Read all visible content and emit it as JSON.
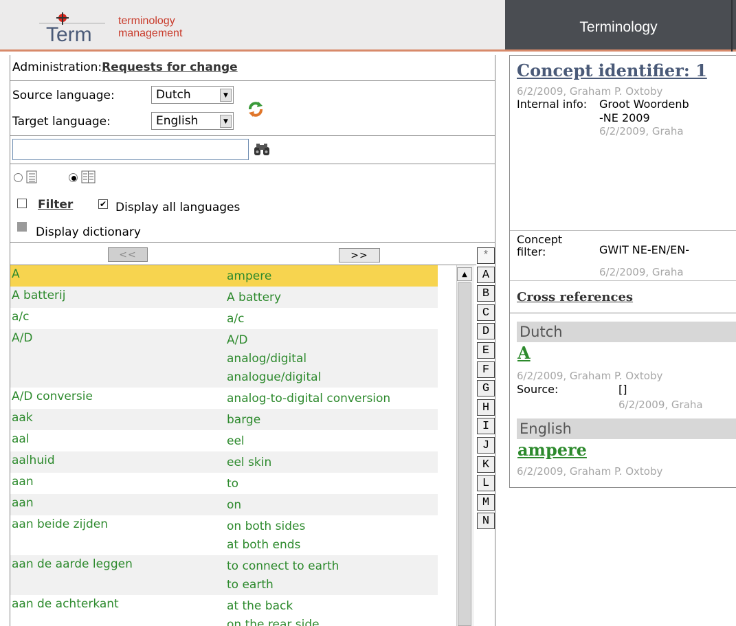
{
  "header": {
    "logo_letters": "Term",
    "logo_line1": "terminology",
    "logo_line2": "management",
    "nav_tab": "Terminology"
  },
  "left": {
    "admin_prefix": "Administration:",
    "admin_link": "Requests for change",
    "source_label": "Source language:",
    "source_value": "Dutch",
    "target_label": "Target language:",
    "target_value": "English",
    "search_value": "",
    "filter_label": "Filter",
    "display_all_label": "Display all languages",
    "display_all_checked": true,
    "display_dict_label": "Display dictionary",
    "prev_label": "<<",
    "next_label": ">>"
  },
  "list": {
    "rows": [
      {
        "src": "A",
        "tgt": [
          "ampere"
        ],
        "selected": true
      },
      {
        "src": "A batterij",
        "tgt": [
          "A battery"
        ]
      },
      {
        "src": "a/c",
        "tgt": [
          "a/c"
        ]
      },
      {
        "src": "A/D",
        "tgt": [
          "A/D",
          "analog/digital",
          "analogue/digital"
        ]
      },
      {
        "src": "A/D conversie",
        "tgt": [
          "analog-to-digital conversion"
        ]
      },
      {
        "src": "aak",
        "tgt": [
          "barge"
        ]
      },
      {
        "src": "aal",
        "tgt": [
          "eel"
        ]
      },
      {
        "src": "aalhuid",
        "tgt": [
          "eel skin"
        ]
      },
      {
        "src": "aan",
        "tgt": [
          "to"
        ]
      },
      {
        "src": "aan",
        "tgt": [
          "on"
        ]
      },
      {
        "src": "aan beide zijden",
        "tgt": [
          "on both sides",
          "at both ends"
        ]
      },
      {
        "src": "aan de aarde leggen",
        "tgt": [
          "to connect to earth",
          "to earth"
        ]
      },
      {
        "src": "aan de achterkant",
        "tgt": [
          "at the back",
          "on the rear side"
        ]
      }
    ]
  },
  "alphabet": [
    "*",
    "A",
    "B",
    "C",
    "D",
    "E",
    "F",
    "G",
    "H",
    "I",
    "J",
    "K",
    "L",
    "M",
    "N"
  ],
  "right": {
    "concept_title": "Concept identifier: 1",
    "meta1": "6/2/2009, Graham P. Oxtoby",
    "internal_label": "Internal info:",
    "internal_value": "Groot Woordenb",
    "internal_value2": "-NE 2009",
    "meta2": "6/2/2009, Graha",
    "concept_filter_label1": "Concept",
    "concept_filter_label2": "filter:",
    "concept_filter_value": "GWIT NE-EN/EN-",
    "meta3": "6/2/2009, Graha",
    "cross_refs": "Cross references",
    "lang1": "Dutch",
    "term1": "A",
    "meta4": "6/2/2009, Graham P. Oxtoby",
    "source_label": "Source:",
    "source_value": "[]",
    "meta5": "6/2/2009, Graha",
    "lang2": "English",
    "term2": "ampere",
    "meta6": "6/2/2009, Graham P. Oxtoby"
  }
}
